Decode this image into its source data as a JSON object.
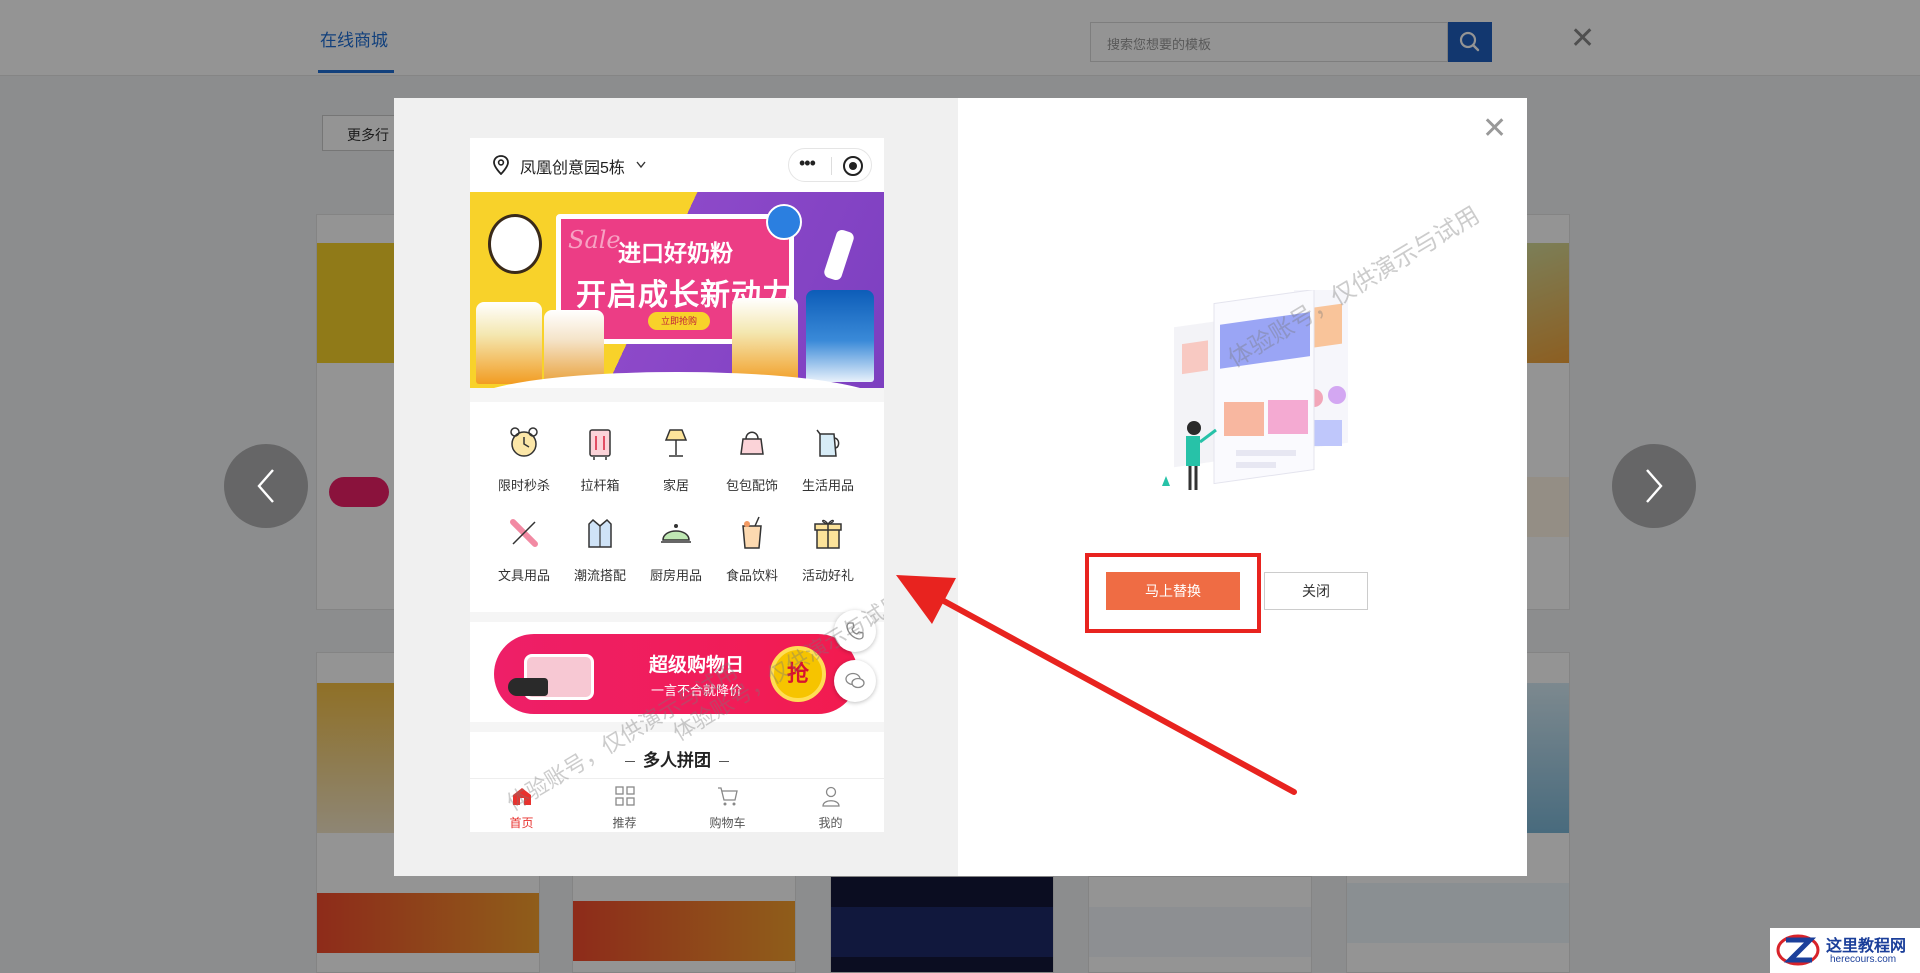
{
  "topbar": {
    "tab_active": "在线商城",
    "search_placeholder": "搜索您想要的模板",
    "more_label": "更多行"
  },
  "modal": {
    "phone": {
      "location": "凤凰创意园5栋",
      "banner": {
        "sale": "Sale",
        "line1": "进口好奶粉",
        "line2": "开启成长新动力",
        "button": "立即抢购"
      },
      "categories": [
        {
          "label": "限时秒杀",
          "icon": "alarm-clock-icon"
        },
        {
          "label": "拉杆箱",
          "icon": "luggage-icon"
        },
        {
          "label": "家居",
          "icon": "lamp-icon"
        },
        {
          "label": "包包配饰",
          "icon": "handbag-icon"
        },
        {
          "label": "生活用品",
          "icon": "kettle-icon"
        },
        {
          "label": "文具用品",
          "icon": "stationery-icon"
        },
        {
          "label": "潮流搭配",
          "icon": "shirt-icon"
        },
        {
          "label": "厨房用品",
          "icon": "cloche-icon"
        },
        {
          "label": "食品饮料",
          "icon": "drink-icon"
        },
        {
          "label": "活动好礼",
          "icon": "gift-icon"
        }
      ],
      "promo": {
        "title": "超级购物日",
        "subtitle": "一言不合就降价",
        "badge": "抢"
      },
      "section_title": "多人拼团",
      "tabbar": [
        {
          "label": "首页",
          "icon": "home-icon",
          "active": true
        },
        {
          "label": "推荐",
          "icon": "grid-icon",
          "active": false
        },
        {
          "label": "购物车",
          "icon": "cart-icon",
          "active": false
        },
        {
          "label": "我的",
          "icon": "user-icon",
          "active": false
        }
      ]
    },
    "watermark": "体验账号，仅供演示与试用",
    "buttons": {
      "replace": "马上替换",
      "close": "关闭"
    }
  },
  "site_logo": {
    "cn": "这里教程网",
    "en": "herecours.com"
  },
  "colors": {
    "accent_blue": "#1f6fd6",
    "replace_button": "#ef6c44",
    "annotation_red": "#e8231f",
    "promo_pink": "#ee1f68"
  }
}
